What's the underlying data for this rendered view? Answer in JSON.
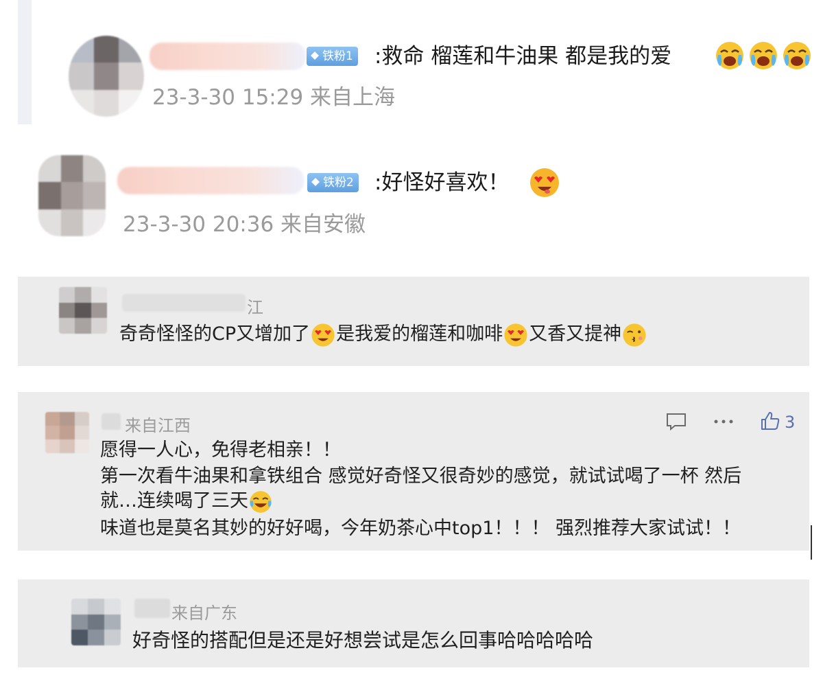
{
  "comments": [
    {
      "badge": "铁粉1",
      "text": ":救命 榴莲和牛油果 都是我的爱",
      "meta": "23-3-30 15:29 来自上海"
    },
    {
      "badge": "铁粉2",
      "text": ":好怪好喜欢！",
      "meta": "23-3-30 20:36 来自安徽"
    }
  ],
  "reply1": {
    "name_fragment": "江",
    "parts": [
      "奇奇怪怪的CP又增加了",
      "是我爱的榴莲和咖啡",
      "又香又提神"
    ]
  },
  "reply2": {
    "location": "来自江西",
    "like_count": "3",
    "lines": [
      "愿得一人心，免得老相亲！！",
      "第一次看牛油果和拿铁组合 感觉好奇怪又很奇妙的感觉，就试试喝了一杯 然后",
      "就…连续喝了三天",
      "味道也是莫名其妙的好好喝，今年奶茶心中top1！！！ 强烈推荐大家试试！！"
    ],
    "icons": [
      "comment-icon",
      "more-icon",
      "thumbs-up-icon"
    ]
  },
  "reply3": {
    "location": "来自广东",
    "text": "好奇怪的搭配但是还是好想尝试是怎么回事哈哈哈哈哈"
  },
  "colors": {
    "badge": "#6aa8e6",
    "meta": "#9a9a9a",
    "panel": "#ececec",
    "like": "#5a6fb0"
  }
}
